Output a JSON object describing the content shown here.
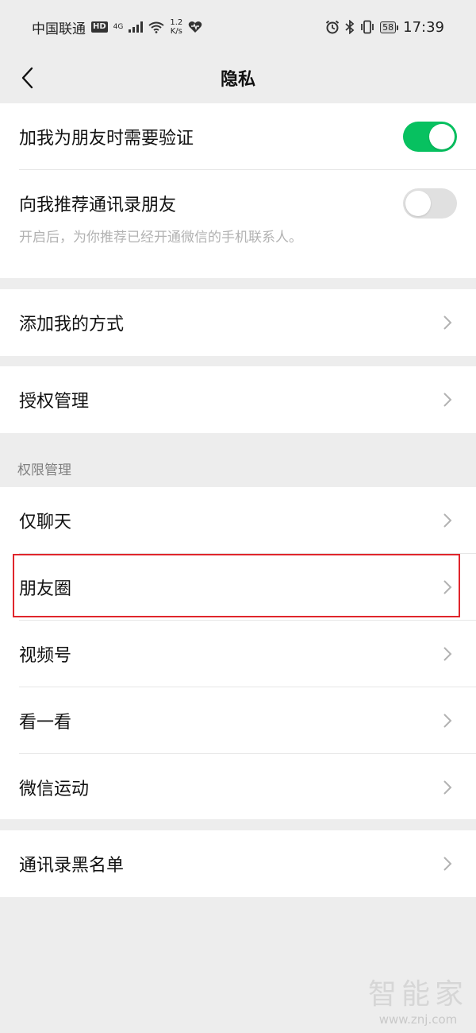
{
  "status_bar": {
    "carrier": "中国联通",
    "hd_badge": "HD",
    "network": "4G",
    "speed_value": "1.2",
    "speed_unit": "K/s",
    "battery": "58",
    "time": "17:39",
    "icons": [
      "signal-icon",
      "wifi-icon",
      "health-icon",
      "alarm-icon",
      "bluetooth-icon",
      "vibrate-icon",
      "battery-icon"
    ]
  },
  "navbar": {
    "back_icon": "chevron-left-icon",
    "title": "隐私"
  },
  "verification_group": {
    "add_verify_label": "加我为朋友时需要验证",
    "add_verify_on": true,
    "recommend_label": "向我推荐通讯录朋友",
    "recommend_on": false,
    "recommend_hint": "开启后，为你推荐已经开通微信的手机联系人。"
  },
  "add_method": {
    "label": "添加我的方式"
  },
  "auth_manage": {
    "label": "授权管理"
  },
  "permissions": {
    "header": "权限管理",
    "items": [
      {
        "label": "仅聊天"
      },
      {
        "label": "朋友圈",
        "highlighted": true
      },
      {
        "label": "视频号"
      },
      {
        "label": "看一看"
      },
      {
        "label": "微信运动"
      }
    ]
  },
  "blacklist": {
    "label": "通讯录黑名单"
  },
  "watermark": {
    "main": "智能家",
    "sub": "www.znj.com"
  },
  "colors": {
    "background": "#ededed",
    "toggle_on": "#07c160",
    "highlight_border": "#e0262c"
  }
}
